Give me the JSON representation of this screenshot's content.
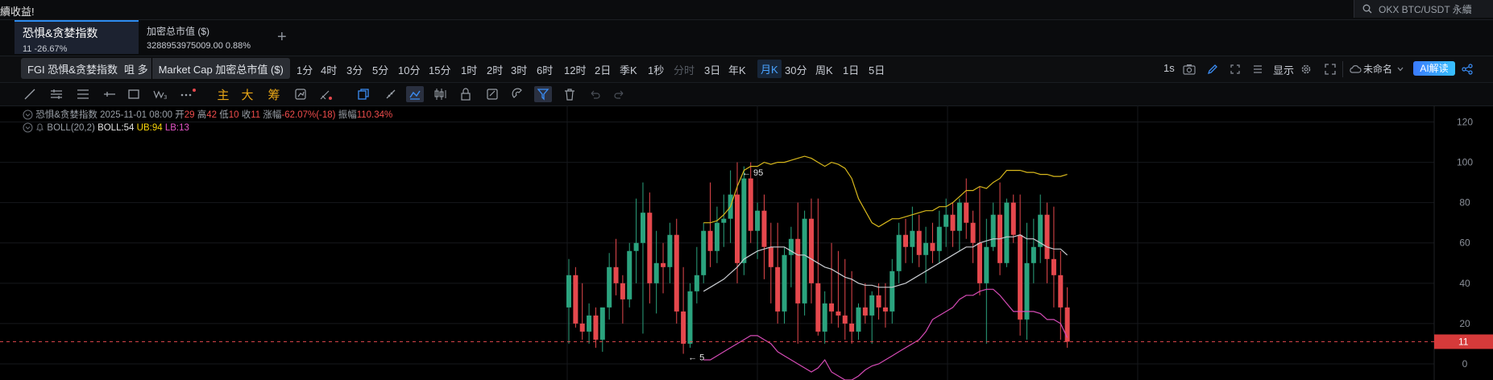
{
  "notice": "續收益!",
  "symbol_search": {
    "text": "OKX BTC/USDT 永續"
  },
  "tabs": [
    {
      "title": "恐惧&贪婪指数",
      "subtitle": "11  -26.67%",
      "active": true
    },
    {
      "title": "加密总市值 ($)",
      "subtitle": "3288953975009.00  0.88%",
      "active": false
    }
  ],
  "add_tab": "+",
  "tooltip": {
    "a": "FGI 恐惧&贪婪指数",
    "hidden": "咀 多",
    "b": "Market Cap 加密总市值 ($)"
  },
  "intervals": [
    "1分",
    "4时",
    "3分",
    "5分",
    "10分",
    "15分",
    "1时",
    "2时",
    "3时",
    "6时",
    "12时",
    "2日",
    "季K",
    "1秒",
    "分时",
    "3日",
    "年K",
    "月K",
    "30分",
    "周K",
    "1日",
    "5日"
  ],
  "active_interval": "月K",
  "disabled_interval": "分时",
  "right_toolbar": {
    "seconds": "1s",
    "display_label": "显示",
    "layout_name": "未命名",
    "ai_label": "AI解读"
  },
  "indicator_buttons": {
    "main": "主",
    "big": "大",
    "chips": "筹"
  },
  "legend": {
    "name": "恐惧&贪婪指数",
    "date": "2025-11-01 08:00",
    "open_label": "开",
    "open": "29",
    "high_label": "高",
    "high": "42",
    "low_label": "低",
    "low": "10",
    "close_label": "收",
    "close": "11",
    "change_label": "涨幅",
    "change": "-62.07%(-18)",
    "amp_label": "振幅",
    "amp": "110.34%"
  },
  "boll": {
    "name": "BOLL(20,2)",
    "mid": "BOLL:54",
    "ub": "UB:94",
    "lb": "LB:13"
  },
  "colors": {
    "up": "#2ba37e",
    "down": "#e5484d",
    "ub": "#d8b81c",
    "mid": "#c9ccd1",
    "lb": "#d64bb6",
    "accent": "#2d8cf0"
  },
  "chart_data": {
    "type": "candlestick",
    "series_name": "恐惧&贪婪指数",
    "ylim": [
      -8,
      125
    ],
    "y_ticks": [
      "120",
      "100",
      "80",
      "60",
      "40",
      "20",
      "0"
    ],
    "last_price_label": "11",
    "last_price": 11,
    "annotations": [
      {
        "text": "95",
        "value": 95
      },
      {
        "text": "5",
        "value": 5
      }
    ],
    "candles": [
      [
        28,
        52,
        10,
        44
      ],
      [
        44,
        48,
        18,
        20
      ],
      [
        20,
        40,
        12,
        16
      ],
      [
        16,
        30,
        10,
        24
      ],
      [
        24,
        28,
        8,
        12
      ],
      [
        12,
        24,
        6,
        28
      ],
      [
        28,
        55,
        22,
        48
      ],
      [
        48,
        62,
        34,
        40
      ],
      [
        40,
        44,
        20,
        32
      ],
      [
        32,
        60,
        28,
        56
      ],
      [
        56,
        82,
        40,
        60
      ],
      [
        60,
        90,
        15,
        75
      ],
      [
        75,
        85,
        30,
        40
      ],
      [
        40,
        66,
        25,
        50
      ],
      [
        50,
        60,
        35,
        48
      ],
      [
        48,
        70,
        40,
        64
      ],
      [
        64,
        72,
        20,
        26
      ],
      [
        26,
        48,
        5,
        10
      ],
      [
        10,
        40,
        8,
        36
      ],
      [
        36,
        58,
        30,
        44
      ],
      [
        44,
        70,
        40,
        66
      ],
      [
        66,
        90,
        48,
        56
      ],
      [
        56,
        78,
        50,
        70
      ],
      [
        70,
        84,
        58,
        72
      ],
      [
        72,
        96,
        60,
        84
      ],
      [
        84,
        100,
        40,
        50
      ],
      [
        50,
        98,
        44,
        92
      ],
      [
        92,
        100,
        60,
        66
      ],
      [
        66,
        80,
        52,
        76
      ],
      [
        76,
        84,
        42,
        58
      ],
      [
        58,
        70,
        30,
        48
      ],
      [
        48,
        70,
        20,
        26
      ],
      [
        26,
        58,
        20,
        54
      ],
      [
        54,
        68,
        38,
        62
      ],
      [
        62,
        80,
        10,
        30
      ],
      [
        30,
        76,
        24,
        72
      ],
      [
        72,
        82,
        30,
        40
      ],
      [
        40,
        82,
        14,
        16
      ],
      [
        16,
        36,
        10,
        30
      ],
      [
        30,
        60,
        20,
        26
      ],
      [
        26,
        56,
        18,
        24
      ],
      [
        24,
        52,
        12,
        20
      ],
      [
        20,
        46,
        10,
        16
      ],
      [
        16,
        30,
        12,
        28
      ],
      [
        28,
        40,
        20,
        24
      ],
      [
        24,
        36,
        10,
        34
      ],
      [
        34,
        40,
        22,
        28
      ],
      [
        28,
        40,
        18,
        26
      ],
      [
        26,
        52,
        20,
        46
      ],
      [
        46,
        70,
        40,
        64
      ],
      [
        64,
        72,
        50,
        58
      ],
      [
        58,
        78,
        50,
        66
      ],
      [
        66,
        74,
        48,
        54
      ],
      [
        54,
        68,
        40,
        60
      ],
      [
        60,
        70,
        50,
        56
      ],
      [
        56,
        76,
        50,
        68
      ],
      [
        68,
        82,
        58,
        74
      ],
      [
        74,
        80,
        58,
        66
      ],
      [
        66,
        82,
        56,
        80
      ],
      [
        80,
        92,
        62,
        70
      ],
      [
        70,
        76,
        50,
        60
      ],
      [
        60,
        88,
        34,
        40
      ],
      [
        40,
        72,
        10,
        58
      ],
      [
        58,
        80,
        56,
        74
      ],
      [
        74,
        90,
        44,
        50
      ],
      [
        50,
        82,
        48,
        80
      ],
      [
        80,
        84,
        60,
        64
      ],
      [
        64,
        84,
        14,
        22
      ],
      [
        22,
        70,
        12,
        50
      ],
      [
        50,
        72,
        40,
        58
      ],
      [
        58,
        84,
        50,
        74
      ],
      [
        74,
        80,
        40,
        52
      ],
      [
        52,
        78,
        28,
        44
      ],
      [
        44,
        56,
        12,
        28
      ],
      [
        28,
        38,
        8,
        11
      ]
    ],
    "boll_ub": [
      null,
      null,
      null,
      null,
      null,
      null,
      null,
      null,
      null,
      null,
      null,
      null,
      null,
      null,
      null,
      null,
      null,
      null,
      null,
      null,
      70,
      70,
      71,
      74,
      78,
      88,
      96,
      98,
      98,
      100,
      99,
      100,
      100,
      101,
      102,
      103,
      102,
      100,
      98,
      100,
      99,
      97,
      92,
      82,
      76,
      70,
      68,
      70,
      72,
      72,
      73,
      74,
      75,
      76,
      76,
      78,
      78,
      80,
      83,
      86,
      86,
      88,
      87,
      90,
      92,
      96,
      96,
      96,
      95,
      95,
      94,
      94,
      93,
      93,
      94
    ],
    "boll_mid": [
      null,
      null,
      null,
      null,
      null,
      null,
      null,
      null,
      null,
      null,
      null,
      null,
      null,
      null,
      null,
      null,
      null,
      null,
      null,
      null,
      36,
      38,
      40,
      42,
      45,
      48,
      52,
      54,
      56,
      57,
      58,
      58,
      58,
      56,
      54,
      54,
      52,
      50,
      48,
      47,
      45,
      43,
      42,
      40,
      39,
      39,
      38,
      38,
      38,
      39,
      40,
      42,
      44,
      46,
      48,
      50,
      52,
      54,
      56,
      58,
      58,
      60,
      61,
      62,
      62,
      63,
      63,
      64,
      62,
      62,
      60,
      58,
      57,
      57,
      54
    ],
    "boll_lb": [
      null,
      null,
      null,
      null,
      null,
      null,
      null,
      null,
      null,
      null,
      null,
      null,
      null,
      null,
      null,
      null,
      null,
      null,
      null,
      null,
      2,
      2,
      4,
      6,
      8,
      10,
      12,
      14,
      14,
      12,
      10,
      6,
      4,
      2,
      0,
      -2,
      -4,
      -2,
      2,
      -4,
      -6,
      -8,
      -8,
      -6,
      -3,
      -1,
      0,
      2,
      4,
      6,
      8,
      10,
      12,
      16,
      22,
      24,
      26,
      28,
      32,
      34,
      34,
      36,
      37,
      37,
      34,
      30,
      26,
      26,
      26,
      26,
      25,
      22,
      22,
      20,
      13
    ]
  }
}
